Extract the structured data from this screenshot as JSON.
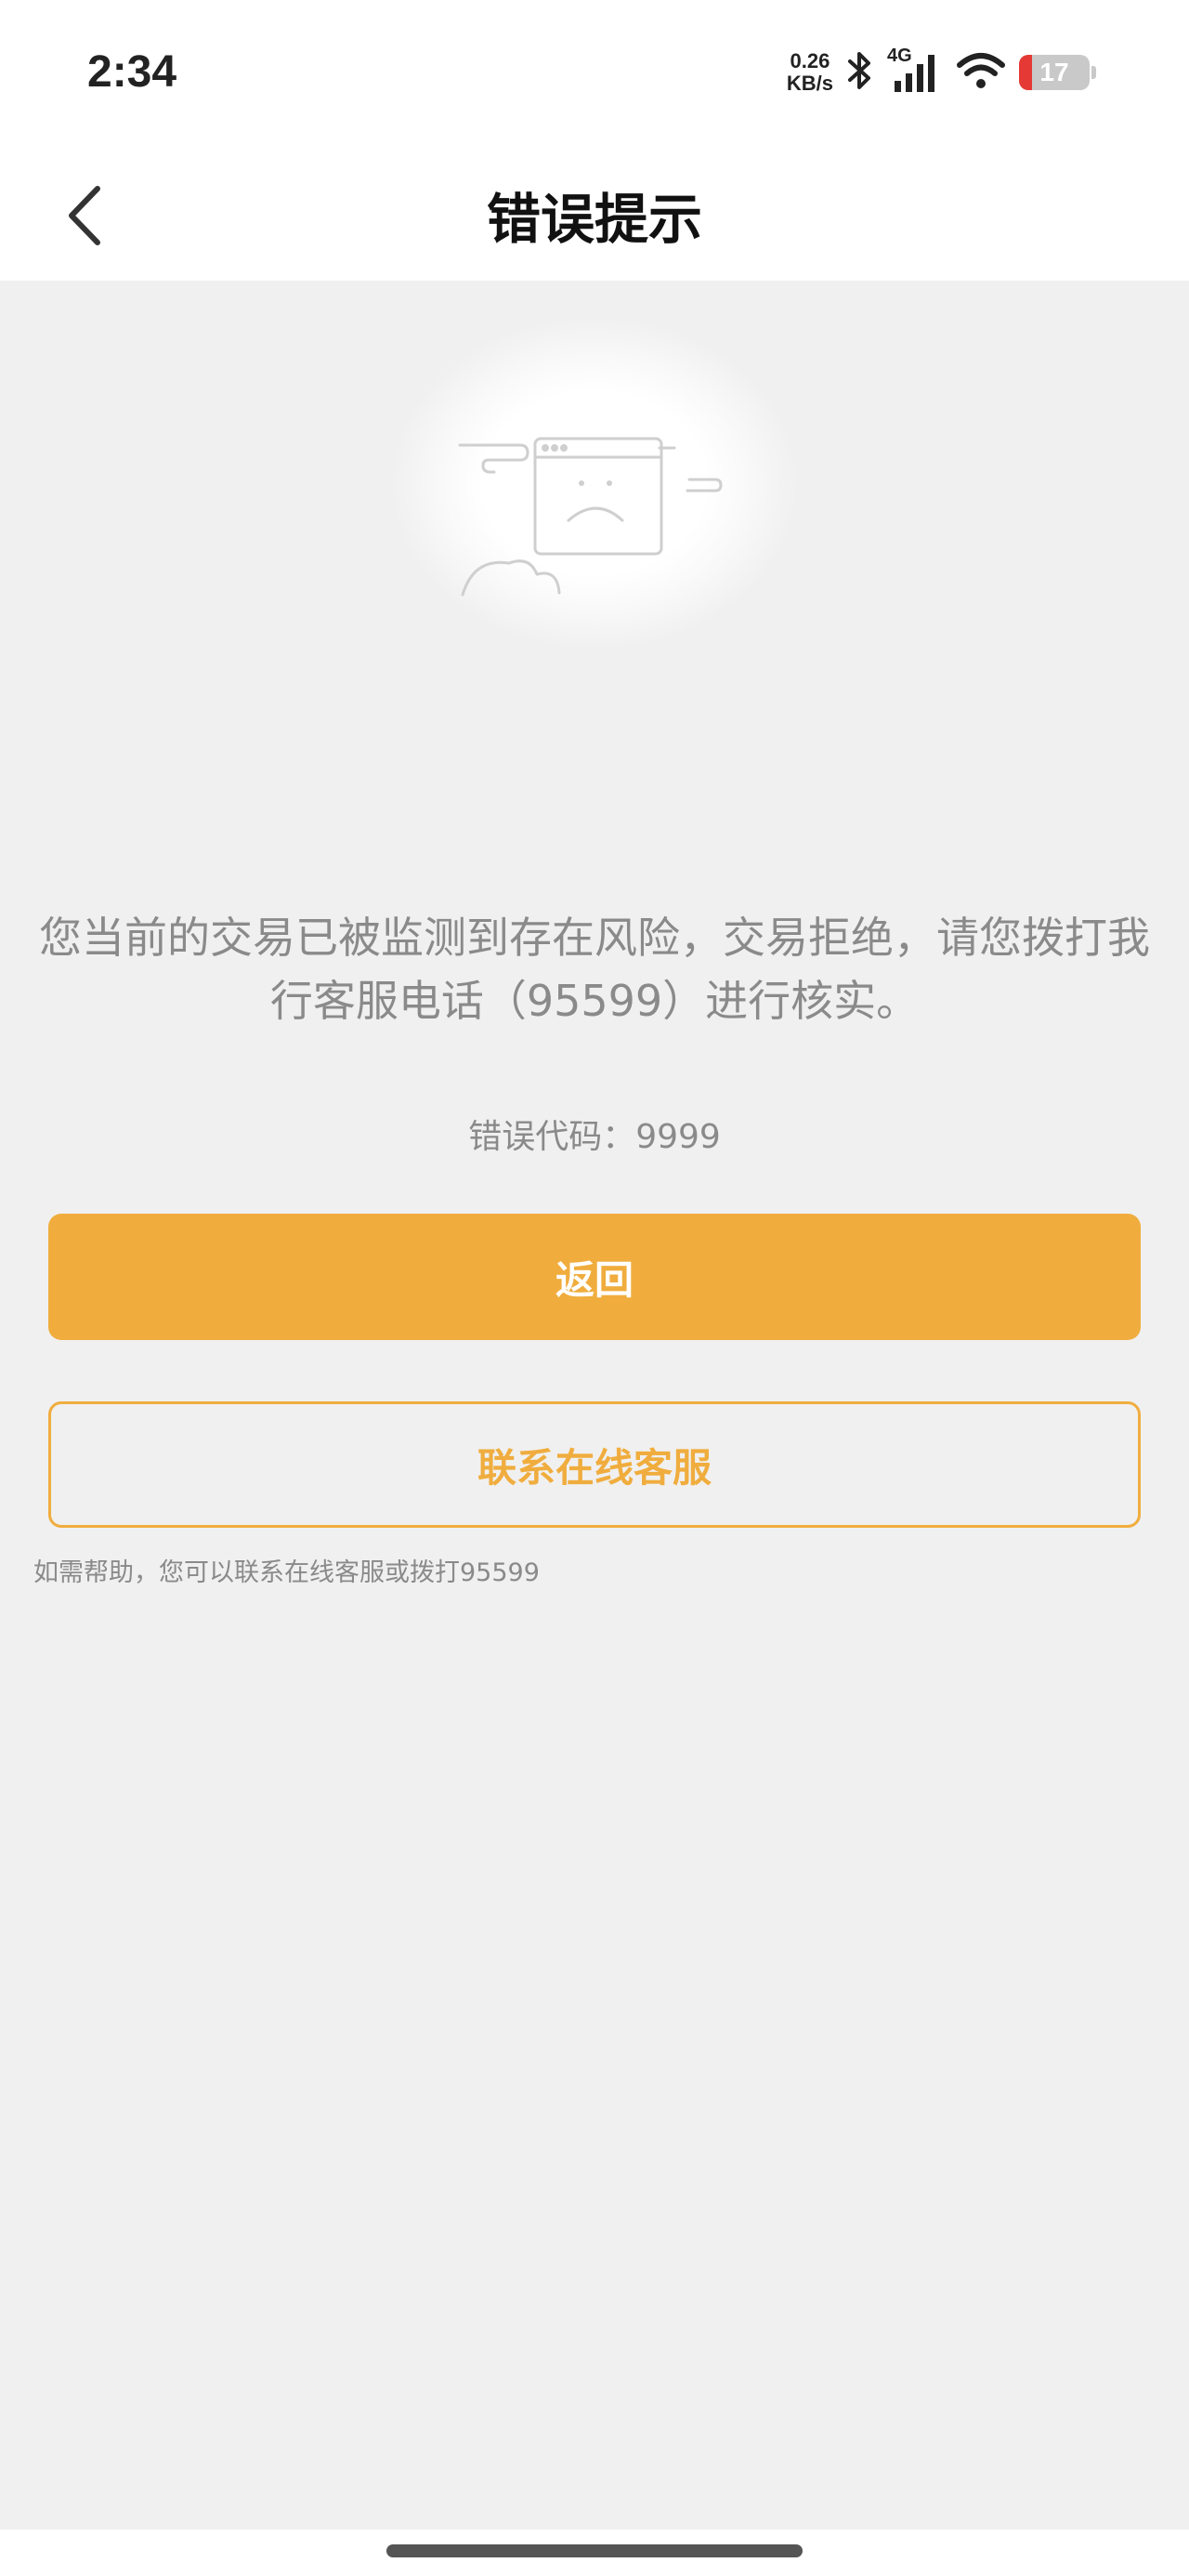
{
  "status_bar": {
    "time": "2:34",
    "net_speed_value": "0.26",
    "net_speed_unit": "KB/s",
    "network_type": "4G",
    "battery_level": "17",
    "battery_low_color": "#e53935"
  },
  "nav": {
    "title": "错误提示",
    "back_icon": "chevron-left-icon"
  },
  "illustration": {
    "icon": "sad-browser-window-icon"
  },
  "content": {
    "message": "您当前的交易已被监测到存在风险，交易拒绝，请您拨打我行客服电话（95599）进行核实。",
    "error_code": "错误代码：9999"
  },
  "buttons": {
    "back_label": "返回",
    "contact_label": "联系在线客服"
  },
  "help_text": "如需帮助，您可以联系在线客服或拨打95599",
  "colors": {
    "accent": "#f0ad3e",
    "background": "#f0f0f0",
    "muted_text": "#8a8a8a"
  }
}
